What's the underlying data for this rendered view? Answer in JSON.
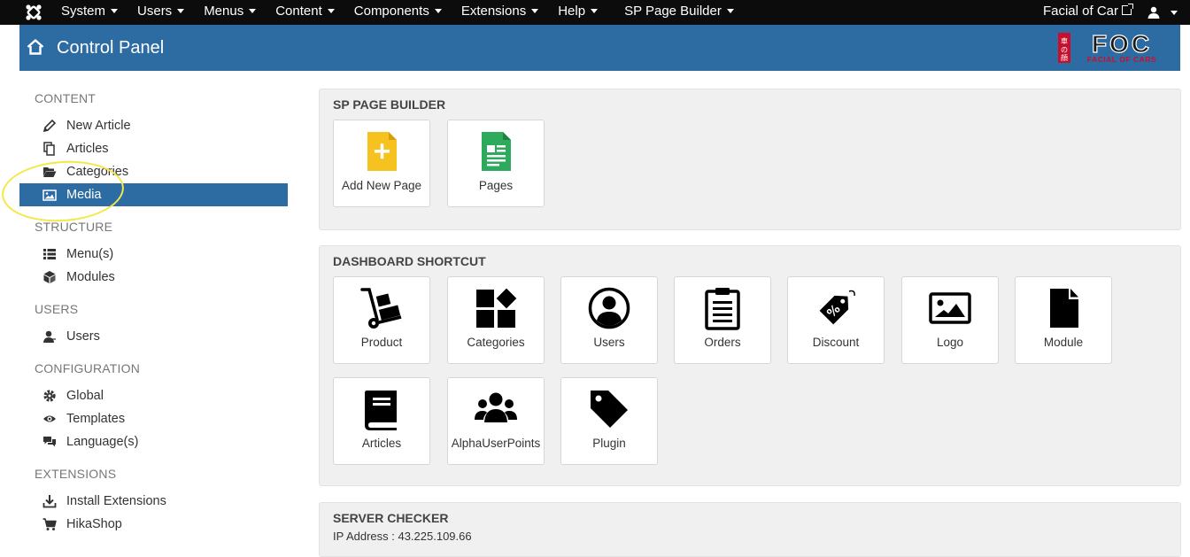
{
  "topbar": {
    "menu": [
      "System",
      "Users",
      "Menus",
      "Content",
      "Components",
      "Extensions",
      "Help",
      "SP Page Builder"
    ],
    "site_link": "Facial of Car"
  },
  "header": {
    "title": "Control Panel",
    "brand_text": "FOC",
    "brand_sub": "FACIAL OF CARS"
  },
  "sidebar": {
    "sections": [
      {
        "title": "CONTENT",
        "items": [
          {
            "label": "New Article",
            "icon": "pencil-icon"
          },
          {
            "label": "Articles",
            "icon": "copy-icon"
          },
          {
            "label": "Categories",
            "icon": "folder-open-icon"
          },
          {
            "label": "Media",
            "icon": "image-icon",
            "active": true
          }
        ]
      },
      {
        "title": "STRUCTURE",
        "items": [
          {
            "label": "Menu(s)",
            "icon": "list-icon"
          },
          {
            "label": "Modules",
            "icon": "cube-icon"
          }
        ]
      },
      {
        "title": "USERS",
        "items": [
          {
            "label": "Users",
            "icon": "user-icon"
          }
        ]
      },
      {
        "title": "CONFIGURATION",
        "items": [
          {
            "label": "Global",
            "icon": "cog-icon"
          },
          {
            "label": "Templates",
            "icon": "eye-icon"
          },
          {
            "label": "Language(s)",
            "icon": "comments-icon"
          }
        ]
      },
      {
        "title": "EXTENSIONS",
        "items": [
          {
            "label": "Install Extensions",
            "icon": "download-icon"
          },
          {
            "label": "HikaShop",
            "icon": "cart-icon"
          }
        ]
      }
    ]
  },
  "panels": {
    "sp_page_builder": {
      "title": "SP PAGE BUILDER",
      "tiles": [
        {
          "label": "Add New Page",
          "icon": "add-page-icon"
        },
        {
          "label": "Pages",
          "icon": "pages-icon"
        }
      ]
    },
    "dashboard_shortcut": {
      "title": "DASHBOARD SHORTCUT",
      "tiles": [
        {
          "label": "Product",
          "icon": "hand-truck-icon"
        },
        {
          "label": "Categories",
          "icon": "categories-icon"
        },
        {
          "label": "Users",
          "icon": "user-circle-icon"
        },
        {
          "label": "Orders",
          "icon": "clipboard-icon"
        },
        {
          "label": "Discount",
          "icon": "discount-tag-icon"
        },
        {
          "label": "Logo",
          "icon": "picture-icon"
        },
        {
          "label": "Module",
          "icon": "file-icon"
        },
        {
          "label": "Articles",
          "icon": "book-icon"
        },
        {
          "label": "AlphaUserPoints",
          "icon": "users-group-icon"
        },
        {
          "label": "Plugin",
          "icon": "tag-icon"
        }
      ]
    },
    "server_checker": {
      "title": "SERVER CHECKER",
      "ip_line": "IP Address : 43.225.109.66"
    }
  }
}
